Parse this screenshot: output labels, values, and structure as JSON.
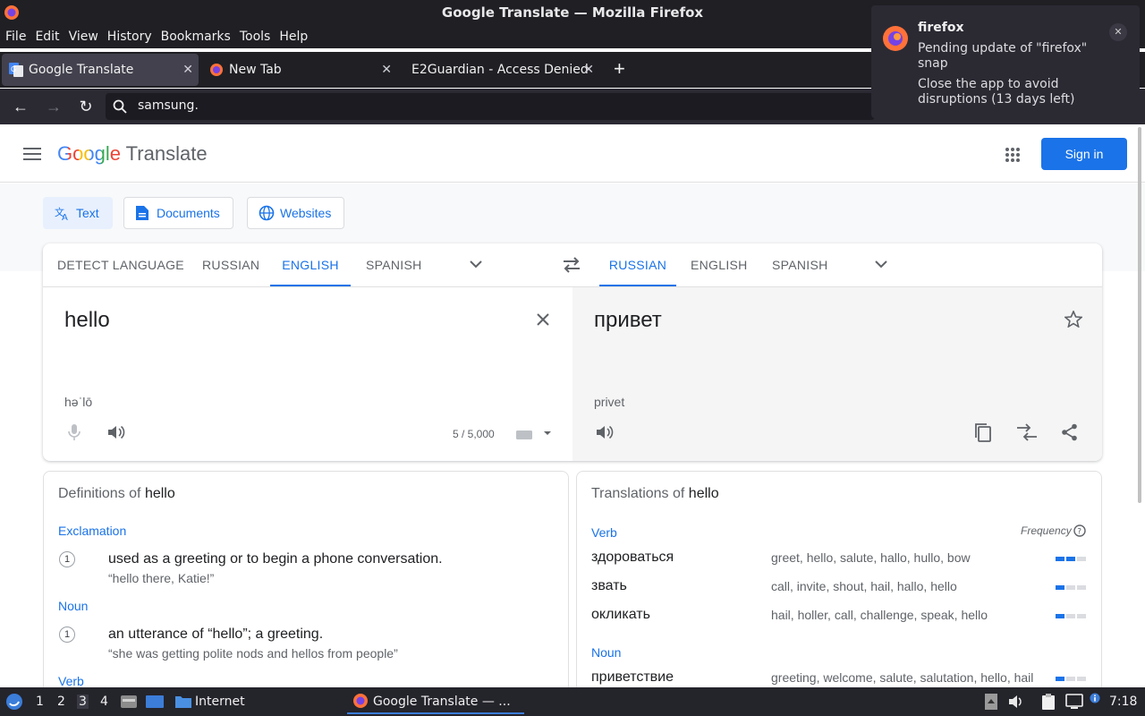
{
  "window": {
    "title": "Google Translate — Mozilla Firefox"
  },
  "menu": [
    "File",
    "Edit",
    "View",
    "History",
    "Bookmarks",
    "Tools",
    "Help"
  ],
  "tabs": [
    {
      "label": "Google Translate"
    },
    {
      "label": "New Tab"
    },
    {
      "label": "E2Guardian - Access Denied"
    }
  ],
  "urlbar": {
    "value": "samsung."
  },
  "notification": {
    "title": "firefox",
    "line1": "Pending update of \"firefox\" snap",
    "line2": "Close the app to avoid disruptions (13 days left)"
  },
  "header": {
    "logo_word": "Google",
    "logo_product": "Translate",
    "signin": "Sign in"
  },
  "modes": [
    "Text",
    "Documents",
    "Websites"
  ],
  "source_langs": [
    "DETECT LANGUAGE",
    "RUSSIAN",
    "ENGLISH",
    "SPANISH"
  ],
  "target_langs": [
    "RUSSIAN",
    "ENGLISH",
    "SPANISH"
  ],
  "source": {
    "text": "hello",
    "phonetic": "həˈlō",
    "count": "5 / 5,000"
  },
  "target": {
    "text": "привет",
    "translit": "privet"
  },
  "definitions": {
    "heading_prefix": "Definitions of ",
    "word": "hello",
    "entries": [
      {
        "pos": "Exclamation",
        "num": "1",
        "def": "used as a greeting or to begin a phone conversation.",
        "ex": "“hello there, Katie!”"
      },
      {
        "pos": "Noun",
        "num": "1",
        "def": "an utterance of “hello”; a greeting.",
        "ex": "“she was getting polite nods and hellos from people”"
      },
      {
        "pos": "Verb"
      }
    ]
  },
  "translations": {
    "heading_prefix": "Translations of ",
    "word": "hello",
    "frequency_label": "Frequency",
    "groups": [
      {
        "pos": "Verb",
        "rows": [
          {
            "word": "здороваться",
            "syn": "greet, hello, salute, hallo, hullo, bow",
            "freq": 2
          },
          {
            "word": "звать",
            "syn": "call, invite, shout, hail, hallo, hello",
            "freq": 1
          },
          {
            "word": "окликать",
            "syn": "hail, holler, call, challenge, speak, hello",
            "freq": 1
          }
        ]
      },
      {
        "pos": "Noun",
        "rows": [
          {
            "word": "приветствие",
            "syn": "greeting, welcome, salute, salutation, hello, hail",
            "freq": 1
          }
        ]
      }
    ]
  },
  "taskbar": {
    "workspaces": [
      "1",
      "2",
      "3",
      "4"
    ],
    "active_ws": "3",
    "folder": "Internet",
    "task": "Google Translate — ...",
    "clock": "7:18"
  },
  "colors": {
    "accent": "#1a73e8",
    "chrome_dark": "#1f1f24"
  }
}
